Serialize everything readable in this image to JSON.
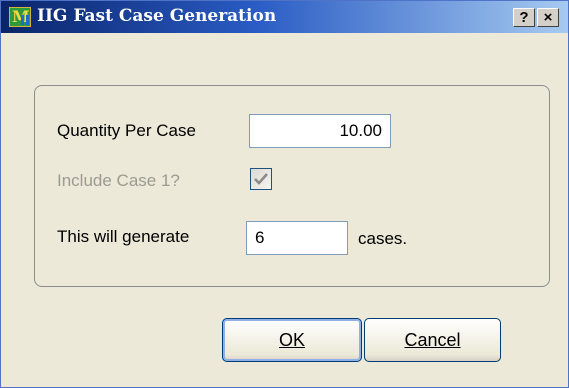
{
  "window": {
    "title": "IIG Fast Case Generation",
    "help_label": "?",
    "close_label": "×"
  },
  "form": {
    "quantity_label": "Quantity Per Case",
    "quantity_value": "10.00",
    "include_case_label": "Include Case 1?",
    "include_case_checked": true,
    "include_case_enabled": false,
    "generate_label": "This will generate",
    "generate_value": "6",
    "generate_suffix": "cases."
  },
  "buttons": {
    "ok_label": "OK",
    "cancel_label": "Cancel"
  },
  "icons": {
    "app": "app-m-icon",
    "check": "checkmark-icon"
  },
  "colors": {
    "title_gradient_start": "#0a246a",
    "title_gradient_end": "#a6caf0",
    "dialog_background": "#ece9d8",
    "disabled_text": "#9c9a92"
  }
}
